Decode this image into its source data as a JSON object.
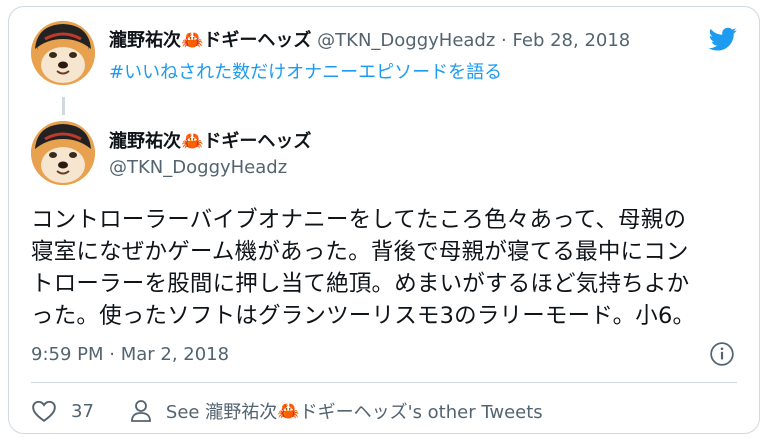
{
  "tweet_parent": {
    "display_name_prefix": "瀧野祐次",
    "display_name_suffix": "ドギーヘッズ",
    "handle": "@TKN_DoggyHeadz",
    "separator": "·",
    "date": "Feb 28, 2018",
    "hashtag": "#いいねされた数だけオナニーエピソードを語る"
  },
  "tweet": {
    "display_name_prefix": "瀧野祐次",
    "display_name_suffix": "ドギーヘッズ",
    "handle": "@TKN_DoggyHeadz",
    "body_lines": [
      "コントローラーバイブオナニーをしてたころ色々あって、母親の",
      "寝室になぜかゲーム機があった。背後で母親が寝てる最中にコン",
      "トローラーを股間に押し当て絶頂。めまいがするほど気持ちよか",
      "った。使ったソフトはグランツーリスモ3のラリーモード。小6。"
    ],
    "timestamp": "9:59 PM · Mar 2, 2018",
    "like_count": "37",
    "see_more_prefix": "See 瀧野祐次",
    "see_more_suffix": "ドギーヘッズ's other Tweets"
  },
  "icons": {
    "logo": "twitter-bird-icon",
    "name_emoji": "crab-emoji-icon",
    "info": "info-icon",
    "like": "heart-icon",
    "profile": "person-icon"
  },
  "colors": {
    "accent": "#1d9bf0",
    "secondary_text": "#536471",
    "border": "#cfd9de"
  }
}
